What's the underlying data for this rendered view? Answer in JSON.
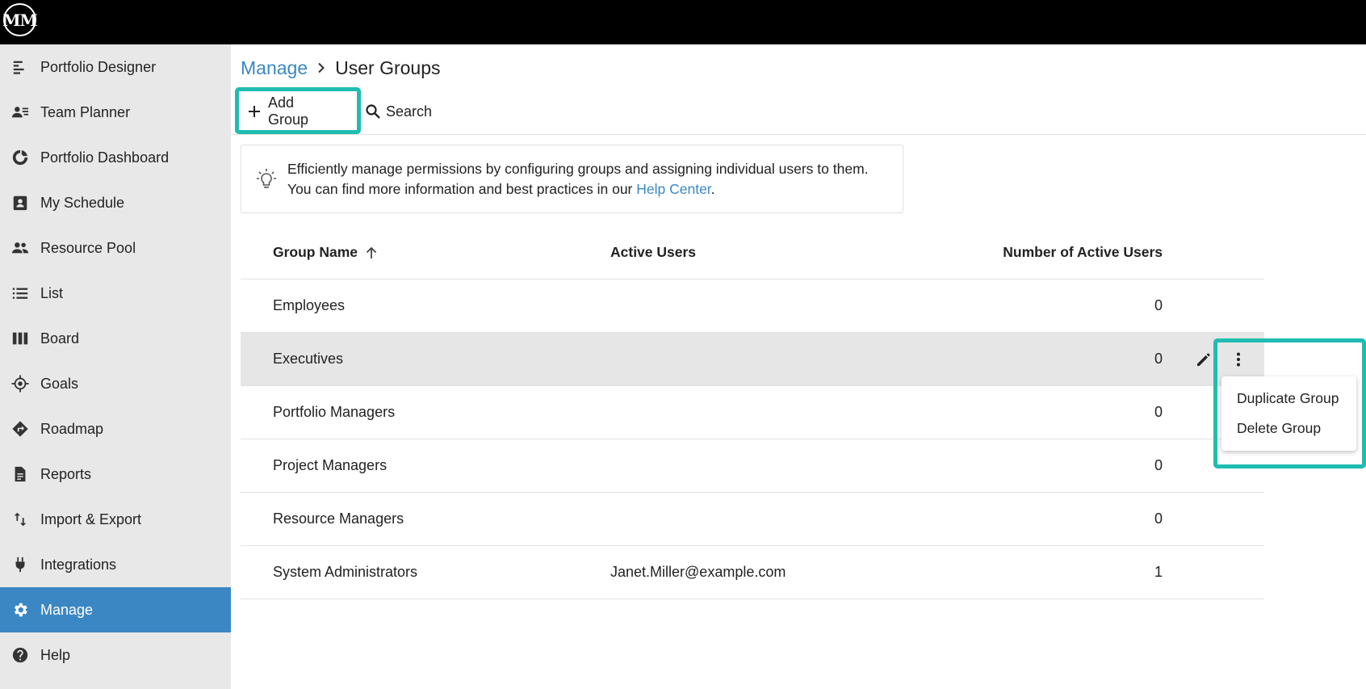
{
  "app": {
    "logo_text": "MM"
  },
  "sidebar": {
    "items": [
      {
        "label": "Portfolio Designer",
        "icon": "portfolio-designer-icon"
      },
      {
        "label": "Team Planner",
        "icon": "team-planner-icon"
      },
      {
        "label": "Portfolio Dashboard",
        "icon": "dashboard-icon"
      },
      {
        "label": "My Schedule",
        "icon": "schedule-icon"
      },
      {
        "label": "Resource Pool",
        "icon": "people-icon"
      },
      {
        "label": "List",
        "icon": "list-icon"
      },
      {
        "label": "Board",
        "icon": "board-icon"
      },
      {
        "label": "Goals",
        "icon": "goals-icon"
      },
      {
        "label": "Roadmap",
        "icon": "roadmap-icon"
      },
      {
        "label": "Reports",
        "icon": "reports-icon"
      },
      {
        "label": "Import & Export",
        "icon": "import-export-icon"
      },
      {
        "label": "Integrations",
        "icon": "plug-icon"
      },
      {
        "label": "Manage",
        "icon": "gear-icon",
        "active": true
      },
      {
        "label": "Help",
        "icon": "help-icon"
      }
    ]
  },
  "breadcrumb": {
    "parent": "Manage",
    "current": "User Groups"
  },
  "toolbar": {
    "add_label": "Add Group",
    "search_label": "Search"
  },
  "info": {
    "line1": "Efficiently manage permissions by configuring groups and assigning individual users to them.",
    "line2_prefix": "You can find more information and best practices in our ",
    "link": "Help Center",
    "line2_suffix": "."
  },
  "table": {
    "headers": {
      "name": "Group Name",
      "active_users": "Active Users",
      "count": "Number of Active Users"
    },
    "rows": [
      {
        "name": "Employees",
        "users": "",
        "count": "0"
      },
      {
        "name": "Executives",
        "users": "",
        "count": "0"
      },
      {
        "name": "Portfolio Managers",
        "users": "",
        "count": "0"
      },
      {
        "name": "Project Managers",
        "users": "",
        "count": "0"
      },
      {
        "name": "Resource Managers",
        "users": "",
        "count": "0"
      },
      {
        "name": "System Administrators",
        "users": "Janet.Miller@example.com",
        "count": "1"
      }
    ]
  },
  "context_menu": {
    "duplicate": "Duplicate Group",
    "delete": "Delete Group"
  },
  "colors": {
    "accent": "#3b87c4",
    "highlight": "#1fbdb1",
    "sidebar_bg": "#e8e8e8",
    "hover_row": "#e6e6e6"
  }
}
